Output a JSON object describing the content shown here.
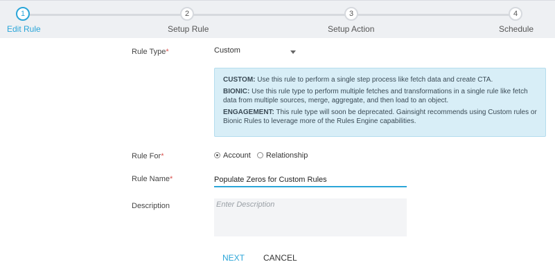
{
  "stepper": {
    "steps": [
      {
        "number": "1",
        "label": "Edit Rule"
      },
      {
        "number": "2",
        "label": "Setup Rule"
      },
      {
        "number": "3",
        "label": "Setup Action"
      },
      {
        "number": "4",
        "label": "Schedule"
      }
    ],
    "active_step": 1
  },
  "form": {
    "rule_type": {
      "label": "Rule Type",
      "required_mark": "*",
      "value": "Custom"
    },
    "info": {
      "custom": {
        "title": "CUSTOM:",
        "text": " Use this rule to perform a single step process like fetch data and create CTA."
      },
      "bionic": {
        "title": "BIONIC:",
        "text": " Use this rule type to perform multiple fetches and transformations in a single rule like fetch data from multiple sources, merge, aggregate, and then load to an object."
      },
      "engagement": {
        "title": "ENGAGEMENT:",
        "text": " This rule type will soon be deprecated. Gainsight recommends using Custom rules or Bionic Rules to leverage more of the Rules Engine capabilities."
      }
    },
    "rule_for": {
      "label": "Rule For",
      "required_mark": "*",
      "options": [
        {
          "label": "Account",
          "checked": true
        },
        {
          "label": "Relationship",
          "checked": false
        }
      ]
    },
    "rule_name": {
      "label": "Rule Name",
      "required_mark": "*",
      "value": "Populate Zeros for Custom Rules"
    },
    "description": {
      "label": "Description",
      "placeholder": "Enter Description"
    }
  },
  "actions": {
    "next_label": "NEXT",
    "cancel_label": "CANCEL"
  },
  "colors": {
    "accent": "#2aa5d8",
    "info_bg": "#d8eef7",
    "required": "#d9534f"
  }
}
